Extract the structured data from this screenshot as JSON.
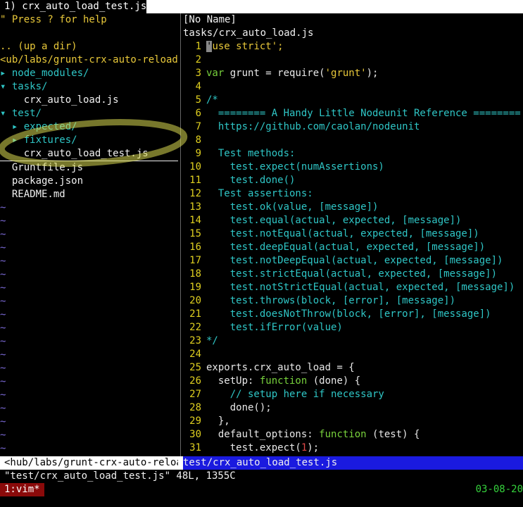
{
  "title": "1) crx_auto_load_test.js",
  "left_pane": {
    "help": "\" Press ? for help",
    "up_dir": ".. (up a dir)",
    "path": "<ub/labs/grunt-crx-auto-reload/",
    "entries": [
      {
        "text": "▸ node_modules/",
        "kind": "dir"
      },
      {
        "text": "▾ tasks/",
        "kind": "dir"
      },
      {
        "text": "    crx_auto_load.js",
        "kind": "file"
      },
      {
        "text": "▾ test/",
        "kind": "dir"
      },
      {
        "text": "  ▸ expected/",
        "kind": "dir"
      },
      {
        "text": "  ▸ fixtures/",
        "kind": "dir"
      },
      {
        "text": "    crx_auto_load_test.js",
        "kind": "file-cursor"
      },
      {
        "text": "  Gruntfile.js",
        "kind": "file"
      },
      {
        "text": "  package.json",
        "kind": "file"
      },
      {
        "text": "  README.md",
        "kind": "file"
      }
    ],
    "tilde": "~"
  },
  "right_pane": {
    "buffer_name": "[No Name]",
    "file_path": "tasks/crx_auto_load.js",
    "lines": [
      {
        "n": "1",
        "segments": [
          {
            "t": "'",
            "c": "cursor"
          },
          {
            "t": "use strict';",
            "c": "str"
          }
        ]
      },
      {
        "n": "2",
        "segments": []
      },
      {
        "n": "3",
        "segments": [
          {
            "t": "var",
            "c": "kw"
          },
          {
            "t": " grunt = require(",
            "c": ""
          },
          {
            "t": "'grunt'",
            "c": "str"
          },
          {
            "t": ");",
            "c": ""
          }
        ]
      },
      {
        "n": "4",
        "segments": []
      },
      {
        "n": "5",
        "segments": [
          {
            "t": "/*",
            "c": "cmt"
          }
        ]
      },
      {
        "n": "6",
        "segments": [
          {
            "t": "  ======== A Handy Little Nodeunit Reference ========",
            "c": "cmt"
          }
        ]
      },
      {
        "n": "7",
        "segments": [
          {
            "t": "  https://github.com/caolan/nodeunit",
            "c": "cmt"
          }
        ]
      },
      {
        "n": "8",
        "segments": []
      },
      {
        "n": "9",
        "segments": [
          {
            "t": "  Test methods:",
            "c": "cmt"
          }
        ]
      },
      {
        "n": "10",
        "segments": [
          {
            "t": "    test.expect(numAssertions)",
            "c": "cmt"
          }
        ]
      },
      {
        "n": "11",
        "segments": [
          {
            "t": "    test.done()",
            "c": "cmt"
          }
        ]
      },
      {
        "n": "12",
        "segments": [
          {
            "t": "  Test assertions:",
            "c": "cmt"
          }
        ]
      },
      {
        "n": "13",
        "segments": [
          {
            "t": "    test.ok(value, [message])",
            "c": "cmt"
          }
        ]
      },
      {
        "n": "14",
        "segments": [
          {
            "t": "    test.equal(actual, expected, [message])",
            "c": "cmt"
          }
        ]
      },
      {
        "n": "15",
        "segments": [
          {
            "t": "    test.notEqual(actual, expected, [message])",
            "c": "cmt"
          }
        ]
      },
      {
        "n": "16",
        "segments": [
          {
            "t": "    test.deepEqual(actual, expected, [message])",
            "c": "cmt"
          }
        ]
      },
      {
        "n": "17",
        "segments": [
          {
            "t": "    test.notDeepEqual(actual, expected, [message])",
            "c": "cmt"
          }
        ]
      },
      {
        "n": "18",
        "segments": [
          {
            "t": "    test.strictEqual(actual, expected, [message])",
            "c": "cmt"
          }
        ]
      },
      {
        "n": "19",
        "segments": [
          {
            "t": "    test.notStrictEqual(actual, expected, [message])",
            "c": "cmt"
          }
        ]
      },
      {
        "n": "20",
        "segments": [
          {
            "t": "    test.throws(block, [error], [message])",
            "c": "cmt"
          }
        ]
      },
      {
        "n": "21",
        "segments": [
          {
            "t": "    test.doesNotThrow(block, [error], [message])",
            "c": "cmt"
          }
        ]
      },
      {
        "n": "22",
        "segments": [
          {
            "t": "    test.ifError(value)",
            "c": "cmt"
          }
        ]
      },
      {
        "n": "23",
        "segments": [
          {
            "t": "*/",
            "c": "cmt"
          }
        ]
      },
      {
        "n": "24",
        "segments": []
      },
      {
        "n": "25",
        "segments": [
          {
            "t": "exports.crx_auto_load = {",
            "c": ""
          }
        ]
      },
      {
        "n": "26",
        "segments": [
          {
            "t": "  setUp: ",
            "c": ""
          },
          {
            "t": "function",
            "c": "kw"
          },
          {
            "t": " (done) {",
            "c": ""
          }
        ]
      },
      {
        "n": "27",
        "segments": [
          {
            "t": "    // setup here if necessary",
            "c": "cmt"
          }
        ]
      },
      {
        "n": "28",
        "segments": [
          {
            "t": "    done();",
            "c": ""
          }
        ]
      },
      {
        "n": "29",
        "segments": [
          {
            "t": "  },",
            "c": ""
          }
        ]
      },
      {
        "n": "30",
        "segments": [
          {
            "t": "  default_options: ",
            "c": ""
          },
          {
            "t": "function",
            "c": "kw"
          },
          {
            "t": " (test) {",
            "c": ""
          }
        ]
      },
      {
        "n": "31",
        "segments": [
          {
            "t": "    test.expect(",
            "c": ""
          },
          {
            "t": "1",
            "c": "num"
          },
          {
            "t": ");",
            "c": ""
          }
        ]
      }
    ]
  },
  "status": {
    "left": "<hub/labs/grunt-crx-auto-reload",
    "right": "test/crx_auto_load_test.js"
  },
  "cmdline": "\"test/crx_auto_load_test.js\" 48L, 1355C",
  "tmux": {
    "window": "1:vim*",
    "date": "03-08-20"
  },
  "colors": {
    "string": "#e8c83a",
    "keyword": "#78d23c",
    "comment": "#2fc6c6",
    "number": "#e04848",
    "tilde": "#7a69d6",
    "status_active": "#1a1adf",
    "tmux_window": "#8a0a0a",
    "tmux_date": "#35d23c",
    "annotation": "#d8d850"
  }
}
